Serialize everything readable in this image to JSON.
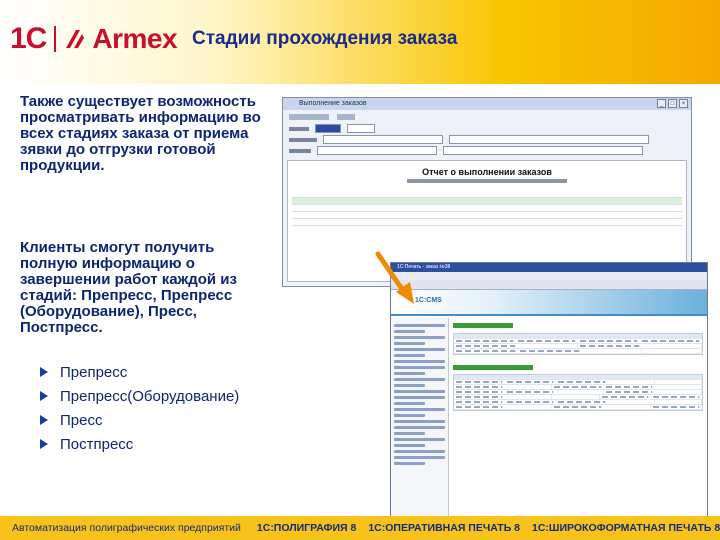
{
  "header": {
    "logo_1c": "1С",
    "logo_armex": "Armex",
    "title": "Стадии прохождения заказа"
  },
  "content": {
    "paragraph1": "Также существует возможность просматривать информацию во всех стадиях заказа от приема зявки до отгрузки готовой продукции.",
    "paragraph2": "Клиенты смогут получить полную информацию о завершении работ каждой из стадий: Препресс, Препресс (Оборудование), Пресс, Постпресс.",
    "bullets": [
      "Препресс",
      "Препресс(Оборудование)",
      "Пресс",
      "Постпресс"
    ]
  },
  "screenshot1": {
    "window_title": "Выполнение заказов",
    "report_title": "Отчет о выполнении заказов"
  },
  "screenshot2": {
    "window_title": "1С:Печать - заказ №38",
    "site_logo": "1С:CMS"
  },
  "footer": {
    "tagline": "Автоматизация полиграфических предприятий",
    "products": [
      "1С:ПОЛИГРАФИЯ 8",
      "1С:ОПЕРАТИВНАЯ ПЕЧАТЬ 8",
      "1С:ШИРОКОФОРМАТНАЯ ПЕЧАТЬ 8"
    ]
  },
  "colors": {
    "brand_red": "#c8102e",
    "title_blue": "#1a2b8c",
    "footer_yellow": "#f7c21a",
    "arrow_orange": "#f08a00"
  }
}
